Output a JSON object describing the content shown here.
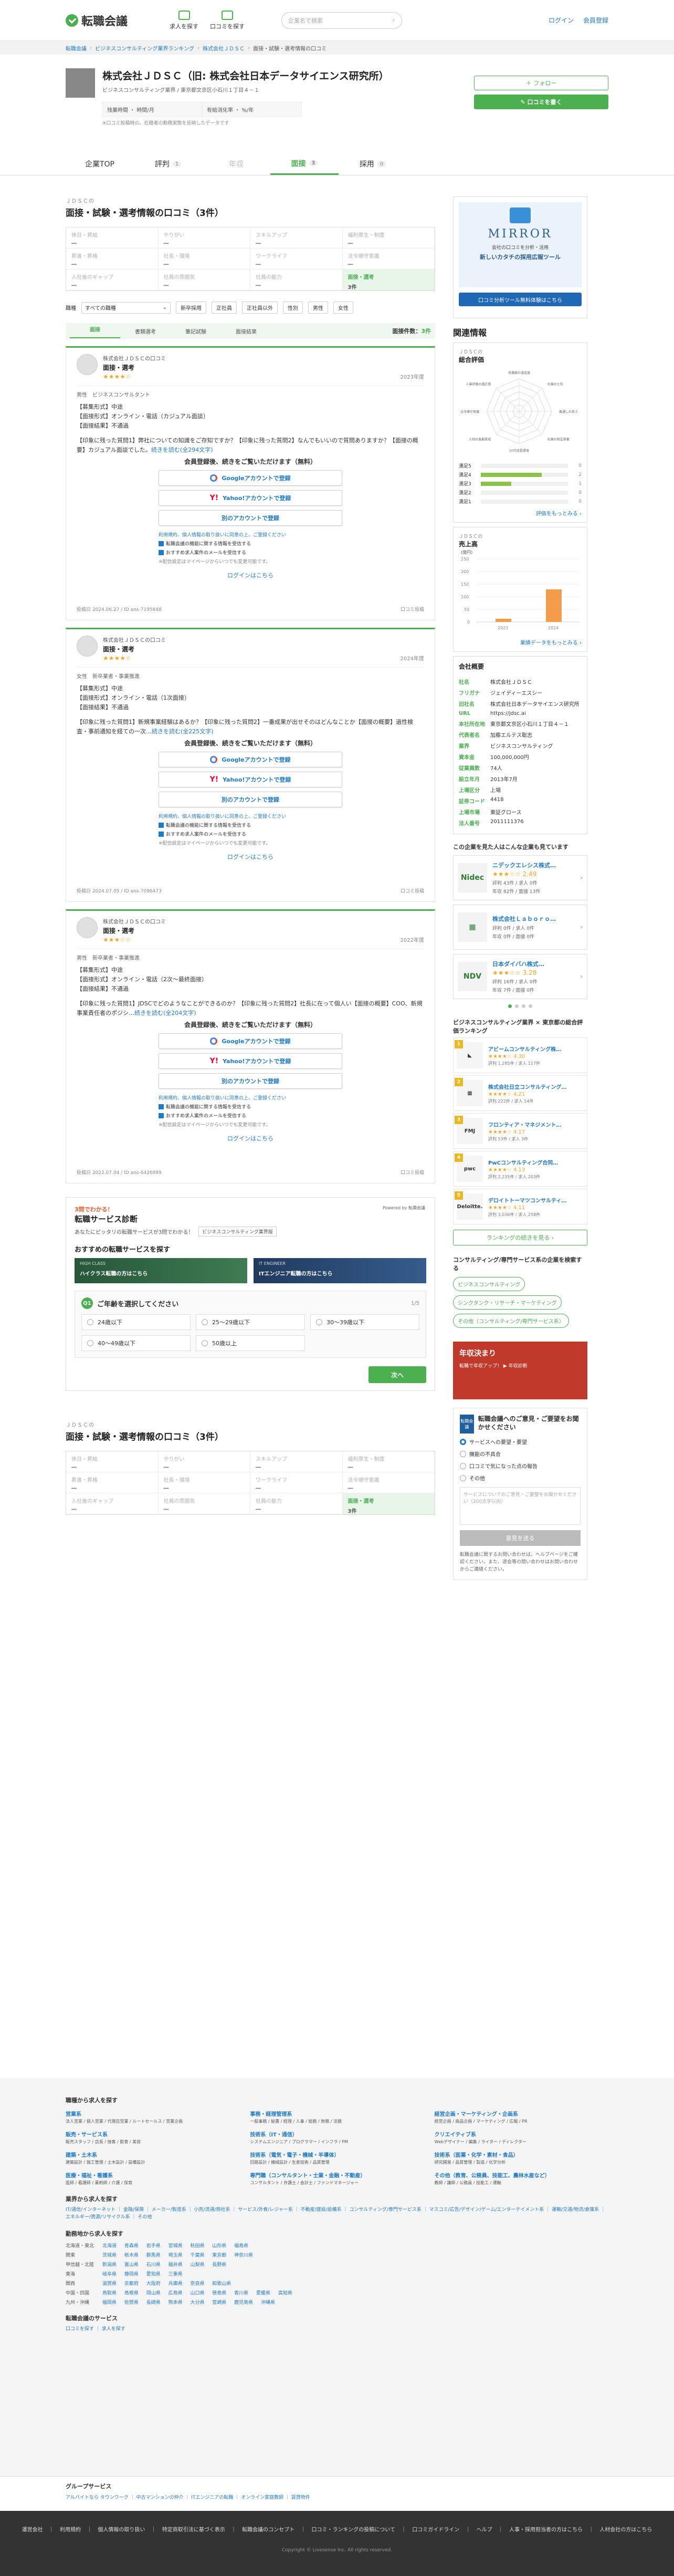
{
  "header": {
    "logo": "転職会議",
    "nav": [
      "求人を探す",
      "口コミを探す"
    ],
    "search_placeholder": "企業名で検索",
    "login": "ログイン",
    "register": "会員登録"
  },
  "breadcrumb": [
    "転職会議",
    "ビジネスコンサルティング業界ランキング",
    "株式会社ＪＤＳＣ",
    "面接・試験・選考情報の口コミ"
  ],
  "company": {
    "name": "株式会社ＪＤＳＣ（旧: 株式会社日本データサイエンス研究所）",
    "address": "ビジネスコンサルティング業界 / 東京都文京区小石川１丁目４－１",
    "stats": [
      {
        "label": "残業時間 ・ 時間/月",
        "value": ""
      },
      {
        "label": "有給消化率 ・ %/年",
        "value": ""
      }
    ],
    "stats_note": "※口コミ投稿時の、在籍者の勤務実態を反映したデータです",
    "follow": "＋ フォロー",
    "post": "✎ 口コミを書く"
  },
  "tabs": [
    {
      "label": "企業TOP",
      "count": ""
    },
    {
      "label": "評判",
      "count": "1"
    },
    {
      "label": "年収",
      "count": ""
    },
    {
      "label": "面接",
      "count": "3"
    },
    {
      "label": "採用",
      "count": "0"
    }
  ],
  "section": {
    "small": "ＪＤＳＣの",
    "title": "面接・試験・選考情報の口コミ（3件）"
  },
  "scores": [
    {
      "label": "休日・昇給",
      "value": "―"
    },
    {
      "label": "やりがい",
      "value": "―"
    },
    {
      "label": "スキルアップ",
      "value": "―"
    },
    {
      "label": "福利厚生・制度",
      "value": "―"
    },
    {
      "label": "昇進・昇格",
      "value": "―"
    },
    {
      "label": "社長・環境",
      "value": "―"
    },
    {
      "label": "ワークライフ",
      "value": "―"
    },
    {
      "label": "法令順守意識",
      "value": "―"
    },
    {
      "label": "入社後のギャップ",
      "value": "―"
    },
    {
      "label": "社員の雰囲気",
      "value": "―"
    },
    {
      "label": "社員の能力",
      "value": "―"
    },
    {
      "label": "面接・選考",
      "value": "3件"
    }
  ],
  "filters": {
    "label": "職種",
    "select": "すべての職種",
    "chips": [
      "新卒採用",
      "正社員",
      "正社員以外",
      "性別",
      "男性",
      "女性"
    ]
  },
  "review_tabs": [
    "面接",
    "書類選考",
    "筆記試験",
    "面接結果"
  ],
  "review_count_label": "面接件数：",
  "review_count": "3件",
  "reviews": [
    {
      "company": "株式会社ＪＤＳＣの口コミ",
      "category": "面接・選考",
      "stars": "★★★★☆",
      "year": "2023年度",
      "meta": "男性　ビジネスコンサルタント",
      "lines": [
        "【募集形式】中途",
        "【面接形式】オンライン・電話（カジュアル面談）",
        "【面接結果】不通過"
      ],
      "body": "【印象に残った質問1】弊社についての知識をご存知ですか？【印象に残った質問2】なんでもいいので質問ありますか？【面接の概要】カジュアル面談でした。",
      "more": "続きを読む(全294文字)",
      "gate_title": "会員登録後、続きをご覧いただけます（無料）",
      "foot_left": "投稿日 2024.06.27 / ID ans-7195848",
      "foot_right": "口コミ投稿"
    },
    {
      "company": "株式会社ＪＤＳＣの口コミ",
      "category": "面接・選考",
      "stars": "★★★★☆",
      "year": "2024年度",
      "meta": "女性　新卒業者・事業推進",
      "lines": [
        "【募集形式】中途",
        "【面接形式】オンライン・電話（1次面接）",
        "【面接結果】不通過"
      ],
      "body": "【印象に残った質問1】新規事業経験はあるか？【印象に残った質問2】一番成果が出せそのはどんなことか【面接の概要】過性検査・事前通知を経ての一次…",
      "more": "続きを読む(全225文字)",
      "gate_title": "会員登録後、続きをご覧いただけます（無料）",
      "foot_left": "投稿日 2024.07.05 / ID ans-7096473",
      "foot_right": "口コミ投稿"
    },
    {
      "company": "株式会社ＪＤＳＣの口コミ",
      "category": "面接・選考",
      "stars": "★★★☆☆",
      "year": "2022年度",
      "meta": "男性　新卒業者・事業推進",
      "lines": [
        "【募集形式】中途",
        "【面接形式】オンライン・電話（2次〜最終面接）",
        "【面接結果】不通過"
      ],
      "body": "【印象に残った質問1】JDSCでどのようなことができるのか？【印象に残った質問2】社長に在って個人い【面接の概要】COO、新規事業責任者のポジシ…",
      "more": "続きを読む(全204文字)",
      "gate_title": "会員登録後、続きをご覧いただけます（無料）",
      "foot_left": "投稿日 2022.07.04 / ID ans-6426899",
      "foot_right": "口コミ投稿"
    }
  ],
  "gate": {
    "google": "Googleアカウントで登録",
    "yahoo": "Yahoo!アカウントで登録",
    "other": "別のアカウントで登録",
    "terms": "利用規約、個人情報の取り扱いに同意の上、ご登録ください",
    "check1": "転職会議の機能に関する情報を受信する",
    "check2": "おすすめ求人案件のメールを受信する",
    "note": "※配信設定はマイページからいつでも変更可能です。",
    "login": "ログインはこちら"
  },
  "diagnosis": {
    "top": "3問でわかる！",
    "title": "転職サービス診断",
    "sub": "あなたにピッタリの転職サービスが3問でわかる！",
    "tag": "ビジネスコンサルティング業界版",
    "powered": "Powered by 転職会議",
    "recommend": "おすすめの転職サービスを探す",
    "card1_small": "HIGH CLASS",
    "card1": "ハイクラス転職の方はこちら",
    "card2_small": "IT ENGINEER",
    "card2": "ITエンジニア転職の方はこちら",
    "q_badge": "Q1",
    "question": "ご年齢を選択してください",
    "page": "1/5",
    "options": [
      "24歳以下",
      "25〜29歳以下",
      "30〜39歳以下",
      "40〜49歳以下",
      "50歳以上"
    ],
    "next": "次へ"
  },
  "section2": {
    "small": "ＪＤＳＣの",
    "title": "面接・試験・選考情報の口コミ（3件）"
  },
  "sidebar": {
    "promo_name": "MIRROR",
    "promo_sub": "会社の口コミを分析・活用",
    "promo_sub2": "新しいカタチの採用広報ツール",
    "promo_btn": "口コミ分析ツール無料体験はこちら",
    "related_title": "関連情報",
    "overall_small": "ＪＤＳＣの",
    "overall_title": "総合評価",
    "radar_labels": [
      "待遇面の満足度",
      "社員の士気",
      "風通しの良さ",
      "社員の相互尊重",
      "20代成長環境",
      "人材の長期育成",
      "法令順守意識",
      "人事評価の適正感"
    ],
    "rating_bars": [
      {
        "label": "満足5",
        "value": 0,
        "count": "0"
      },
      {
        "label": "満足4",
        "value": 0.7,
        "count": "2"
      },
      {
        "label": "満足3",
        "value": 0.35,
        "count": "1"
      },
      {
        "label": "満足2",
        "value": 0,
        "count": "0"
      },
      {
        "label": "満足1",
        "value": 0,
        "count": "0"
      }
    ],
    "more1": "評価をもっとみる ›",
    "sales_small": "ＪＤＳＣの",
    "sales_title": "売上高",
    "sales_unit": "(億円)",
    "sales_more": "業績データをもっとみる ›",
    "overview_title": "会社概要",
    "overview": [
      {
        "k": "社名",
        "v": "株式会社ＪＤＳＣ"
      },
      {
        "k": "フリガナ",
        "v": "ジェイディーエスシー"
      },
      {
        "k": "旧社名",
        "v": "株式会社日本データサイエンス研究所"
      },
      {
        "k": "URL",
        "v": "https://jdsc.ai"
      },
      {
        "k": "本社所在地",
        "v": "東京都文京区小石川１丁目４－１"
      },
      {
        "k": "代表者名",
        "v": "加藤エルテス聡志"
      },
      {
        "k": "業界",
        "v": "ビジネスコンサルティング"
      },
      {
        "k": "資本金",
        "v": "100,000,000円"
      },
      {
        "k": "従業員数",
        "v": "74人"
      },
      {
        "k": "設立年月",
        "v": "2013年7月"
      },
      {
        "k": "上場区分",
        "v": "上場"
      },
      {
        "k": "証券コード",
        "v": "4418"
      },
      {
        "k": "上場市場",
        "v": "東証グロース"
      },
      {
        "k": "法人番号",
        "v": "2011111376"
      }
    ],
    "also_viewed": "この企業を見た人はこんな企業も見ています",
    "related": [
      {
        "logo": "Nidec",
        "name": "ニデックエレシス株式…",
        "score": "★★★☆☆ 2.49",
        "sub1": "評判 43件 / 求人 0件",
        "sub2": "年収 82件 / 面接 13件"
      },
      {
        "logo": "▦",
        "name": "株式会社Ｌａｂｏｒｏ…",
        "score": "",
        "sub1": "評判 0件 / 求人 0件",
        "sub2": "年収 0件 / 面接 0件"
      },
      {
        "logo": "NDV",
        "name": "日本ダイバハ株式…",
        "score": "★★★☆☆ 3.28",
        "sub1": "評判 16件 / 求人 0件",
        "sub2": "年収 7件 / 面接 0件"
      }
    ],
    "ranking_title": "ビジネスコンサルティング業界 × 東京都の総合評価ランキング",
    "ranking": [
      {
        "no": "1",
        "logo": "◣",
        "name": "アビームコンサルティング株…",
        "score": "★★★★☆ 4.30",
        "sub": "評判 1,285件 / 求人 117件"
      },
      {
        "no": "2",
        "logo": "▦",
        "name": "株式会社日立コンサルティング…",
        "score": "★★★★☆ 4.21",
        "sub": "評判 222件 / 求人 14件"
      },
      {
        "no": "3",
        "logo": "FMJ",
        "name": "フロンティア・マネジメント…",
        "score": "★★★★☆ 4.17",
        "sub": "評判 53件 / 求人 3件"
      },
      {
        "no": "4",
        "logo": "pwc",
        "name": "PwCコンサルティング合同…",
        "score": "★★★★☆ 4.13",
        "sub": "評判 2,235件 / 求人 203件"
      },
      {
        "no": "5",
        "logo": "Deloitte.",
        "name": "デロイトトーマツコンサルティ…",
        "score": "★★★★☆ 4.11",
        "sub": "評判 3,036件 / 求人 258件"
      }
    ],
    "ranking_btn": "ランキングの続きを見る ›",
    "consult_title": "コンサルティング/専門サービス系の企業を検索する",
    "consult_tags": [
      "ビジネスコンサルティング",
      "シンクタンク・リサーチ・マーケティング",
      "その他（コンサルティング/専門サービス系）"
    ],
    "banner1": "年収決まり",
    "banner2": "転職で年収アップ！ ▶ 年収診断",
    "feedback_icon": "転職会議",
    "feedback_title": "転職会議へのご意見・ご要望をお聞かせください",
    "feedback_options": [
      "サービスへの要望・要望",
      "機能の不具合",
      "口コミで気になった点の報告",
      "その他"
    ],
    "feedback_placeholder": "サービスについてのご意見・ご要望をお聞かせください（200文字以内）",
    "feedback_btn": "意見を送る",
    "feedback_note": "転職会議に関するお問い合わせは、ヘルプページをご確認ください。また、退会等の問い合わせはお問い合わせからご連絡ください。"
  },
  "footer": {
    "title": "職種から求人を探す",
    "categories": [
      {
        "h": "営業系",
        "t": "法人営業 / 個人営業 / 代理店営業 / ルートセールス / 営業企画"
      },
      {
        "h": "事務・経理管理系",
        "t": "一般事務 / 秘書 / 経理 / 人事 / 総務 / 財務 / 法務"
      },
      {
        "h": "経営企画・マーケティング・企画系",
        "t": "経営企画 / 商品企画 / マーケティング / 広報 / PR"
      },
      {
        "h": "販売・サービス系",
        "t": "販売スタッフ / 店長 / 接客 / 飲食 / 美容"
      },
      {
        "h": "技術系（IT・通信）",
        "t": "システムエンジニア / プログラマー / インフラ / PM"
      },
      {
        "h": "クリエイティブ系",
        "t": "Webデザイナー / 編集 / ライター / ディレクター"
      },
      {
        "h": "建築・土木系",
        "t": "建築設計 / 施工管理 / 土木設計 / 設備設計"
      },
      {
        "h": "技術系（電気・電子・機械・半導体）",
        "t": "回路設計 / 機械設計 / 生産技術 / 品質管理"
      },
      {
        "h": "技術系（医薬・化学・素材・食品）",
        "t": "研究開発 / 品質管理 / 製造 / 化学分析"
      },
      {
        "h": "医療・福祉・看護系",
        "t": "医師 / 看護師 / 薬剤師 / 介護 / 保育"
      },
      {
        "h": "専門職（コンサルタント・士業・金融・不動産）",
        "t": "コンサルタント / 弁護士 / 会計士 / ファンドマネージャー"
      },
      {
        "h": "その他（教育、公務員、技能工、農林水産など）",
        "t": "教師 / 講師 / 公務員 / 技能工 / 運輸"
      }
    ],
    "industry_title": "業界から求人を探す",
    "industries": "IT/通信/インターネット ｜ 金融/保険 ｜ メーカー/製造系 ｜ 小売/流通/商社系 ｜ サービス/外食/レジャー系 ｜ 不動産/建設/設備系 ｜ コンサルティング/専門サービス系 ｜ マスコミ/広告/デザイン/ゲーム/エンターテイメント系 ｜ 運輸/交通/物流/倉庫系 ｜ エネルギー/資源/リサイクル系 ｜ その他",
    "pref_title": "勤務地から求人を探す",
    "prefs": [
      {
        "r": "北海道・東北",
        "v": "北海道 青森県 岩手県 宮城県 秋田県 山形県 福島県"
      },
      {
        "r": "関東",
        "v": "茨城県 栃木県 群馬県 埼玉県 千葉県 東京都 神奈川県"
      },
      {
        "r": "甲信越・北陸",
        "v": "新潟県 富山県 石川県 福井県 山梨県 長野県"
      },
      {
        "r": "東海",
        "v": "岐阜県 静岡県 愛知県 三重県"
      },
      {
        "r": "関西",
        "v": "滋賀県 京都府 大阪府 兵庫県 奈良県 和歌山県"
      },
      {
        "r": "中国・四国",
        "v": "鳥取県 島根県 岡山県 広島県 山口県 徳島県 香川県 愛媛県 高知県"
      },
      {
        "r": "九州・沖縄",
        "v": "福岡県 佐賀県 長崎県 熊本県 大分県 宮崎県 鹿児島県 沖縄県"
      }
    ],
    "service_title": "転職会議のサービス",
    "services": "口コミを探す ｜ 求人を探す",
    "group_title": "グループサービス",
    "group": "アルバイトなら タウンワーク ｜ 中古マンションの仲介 ｜ ITエンジニアの転職 ｜ オンライン家庭教師 ｜ 賃貸物件",
    "links": "運営会社 ｜ 利用規約 ｜ 個人情報の取り扱い ｜ 特定商取引法に基づく表示 ｜ 転職会議のコンセプト ｜ 口コミ・ランキングの投稿について ｜ 口コミガイドライン ｜ ヘルプ ｜ 人事・採用担当者の方はこちら ｜ 人材会社の方はこちら",
    "copyright": "Copyright © Livesense Inc. All rights reserved."
  }
}
